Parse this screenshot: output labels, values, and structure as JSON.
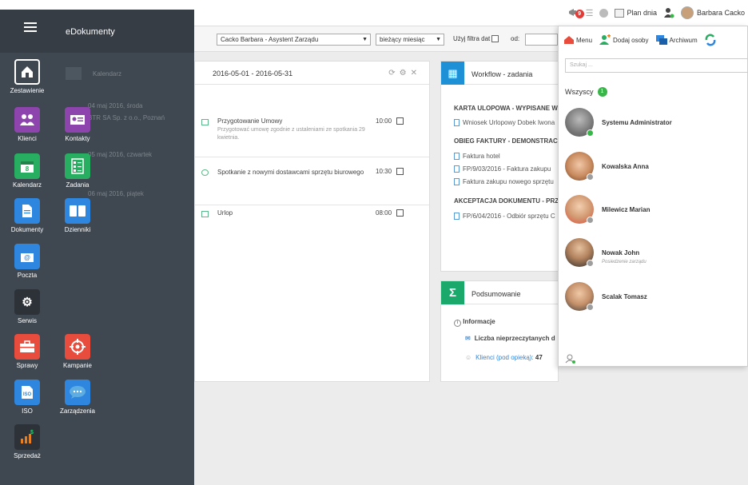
{
  "app": {
    "title": "eDokumenty"
  },
  "topbar": {
    "notif_count": "9",
    "plan_label": "Plan dnia",
    "user_name": "Barbara Cacko"
  },
  "filter": {
    "person_select": "Cacko Barbara - Asystent Zarządu",
    "period_select": "bieżący miesiąc",
    "use_date_filter_label": "Użyj filtra dat",
    "from_label": "od:"
  },
  "sidebar": {
    "items": [
      {
        "label": "Zestawienie",
        "icon": "house-icon",
        "color": "#3f4750"
      },
      {
        "label": "Klienci",
        "icon": "people-icon",
        "color": "#8e44ad"
      },
      {
        "label": "Kontakty",
        "icon": "contact-card-icon",
        "color": "#8e44ad"
      },
      {
        "label": "Kalendarz",
        "icon": "calendar-icon",
        "color": "#27ae60"
      },
      {
        "label": "Zadania",
        "icon": "tasks-icon",
        "color": "#27ae60"
      },
      {
        "label": "Dokumenty",
        "icon": "document-icon",
        "color": "#2e86de"
      },
      {
        "label": "Dzienniki",
        "icon": "book-icon",
        "color": "#2e86de"
      },
      {
        "label": "Poczta",
        "icon": "mail-icon",
        "color": "#2e86de"
      },
      {
        "label": "Serwis",
        "icon": "gears-icon",
        "color": "#2d3238"
      },
      {
        "label": "Sprawy",
        "icon": "briefcase-icon",
        "color": "#e74c3c"
      },
      {
        "label": "Kampanie",
        "icon": "target-icon",
        "color": "#e74c3c"
      },
      {
        "label": "ISO",
        "icon": "iso-icon",
        "color": "#2e86de"
      },
      {
        "label": "Zarządzenia",
        "icon": "chat-bubble-icon",
        "color": "#2e86de"
      },
      {
        "label": "Sprzedaż",
        "icon": "sales-chart-icon",
        "color": "#2d3238"
      }
    ],
    "faded": {
      "calendar_label": "Kalendarz",
      "day1": "04 maj 2016, środa",
      "company": "BTR SA Sp. z o.o., Poznań",
      "day2": "05 maj 2016, czwartek",
      "day3": "06 maj 2016, piątek"
    }
  },
  "calendar": {
    "range": "2016-05-01 - 2016-05-31",
    "events": [
      {
        "title": "Przygotowanie Umowy",
        "desc": "Przygotować umowę zgodnie z ustaleniami ze spotkania 29 kwietnia.",
        "time": "10:00"
      },
      {
        "title": "Spotkanie z nowymi dostawcami sprzętu biurowego",
        "desc": "",
        "time": "10:30"
      },
      {
        "title": "Urlop",
        "desc": "",
        "time": "08:00"
      }
    ]
  },
  "workflow": {
    "title": "Workflow - zadania",
    "sections": [
      {
        "heading": "KARTA ULOPOWA - WYPISANE W",
        "items": [
          "Wniosek Urlopowy Dobek Iwona"
        ]
      },
      {
        "heading": "OBIEG FAKTURY - DEMONSTRACY",
        "items": [
          "Faktura hotel",
          "FP/9/03/2016 - Faktura zakupu",
          "Faktura zakupu nowego sprzętu"
        ]
      },
      {
        "heading": "AKCEPTACJA DOKUMENTU - PRZY",
        "items": [
          "FP/6/04/2016 - Odbiór sprzętu C"
        ]
      }
    ]
  },
  "summary": {
    "title": "Podsumowanie",
    "info_heading": "Informacje",
    "unread_label": "Liczba nieprzeczytanych d",
    "clients_label": "Klienci (pod opieką):",
    "clients_value": "47"
  },
  "contacts_popup": {
    "menu_label": "Menu",
    "add_label": "Dodaj osoby",
    "archive_label": "Archiwum",
    "search_placeholder": "Szukaj ...",
    "all_label": "Wszyscy",
    "all_count": "1",
    "people": [
      {
        "name": "Systemu Administrator",
        "sub": "",
        "status": "online"
      },
      {
        "name": "Kowalska Anna",
        "sub": "",
        "status": "offline"
      },
      {
        "name": "Milewicz Marian",
        "sub": "",
        "status": "offline"
      },
      {
        "name": "Nowak John",
        "sub": "Posiedzenie zarządu",
        "status": "offline"
      },
      {
        "name": "Scalak Tomasz",
        "sub": "",
        "status": "offline"
      }
    ]
  }
}
